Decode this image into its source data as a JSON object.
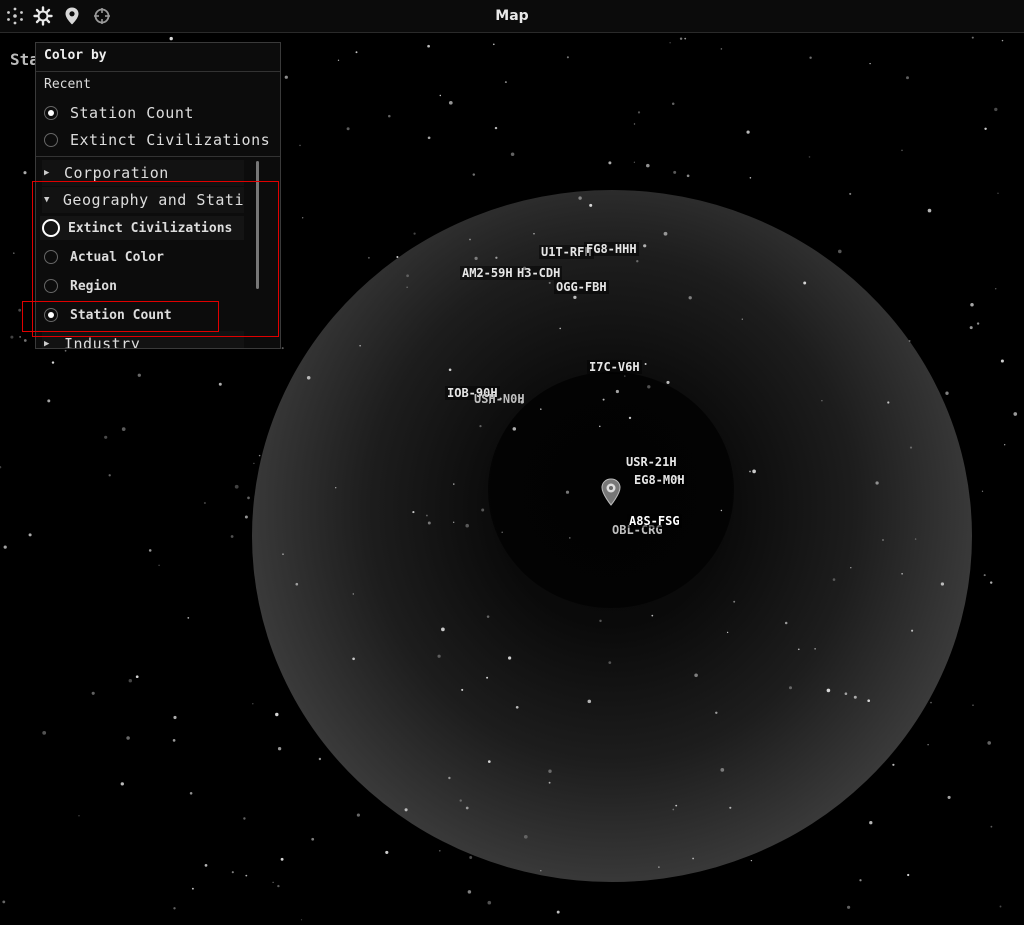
{
  "app": {
    "title": "Map"
  },
  "toolbar": {
    "icons": [
      "network-icon",
      "gear-icon",
      "map-pin-icon",
      "crosshair-icon"
    ]
  },
  "page": {
    "title": "Station Count"
  },
  "color_by_menu": {
    "header": "Color by",
    "recent_label": "Recent",
    "recent_options": [
      {
        "label": "Station Count",
        "selected": true
      },
      {
        "label": "Extinct Civilizations",
        "selected": false
      }
    ],
    "categories": [
      {
        "label": "Corporation",
        "expanded": false
      },
      {
        "label": "Geography and Stati",
        "expanded": true
      },
      {
        "label": "Industry",
        "expanded": false
      }
    ],
    "geography_options": [
      {
        "label": "Extinct Civilizations",
        "selected": false,
        "focused": true
      },
      {
        "label": "Actual Color",
        "selected": false
      },
      {
        "label": "Region",
        "selected": false
      },
      {
        "label": "Station Count",
        "selected": true
      }
    ]
  },
  "map": {
    "systems": [
      "U1T-RFH",
      "FG8-HHH",
      "AM2-59H",
      "H3-CDH",
      "OGG-FBH",
      "I7C-V6H",
      "IOB-90H",
      "USH-N0H",
      "USR-21H",
      "EG8-M0H",
      "A8S-FSG",
      "OBL-CRG"
    ],
    "current_location_icon": "location-marker-icon"
  },
  "colors": {
    "background": "#000000",
    "highlight": "#e00000"
  }
}
